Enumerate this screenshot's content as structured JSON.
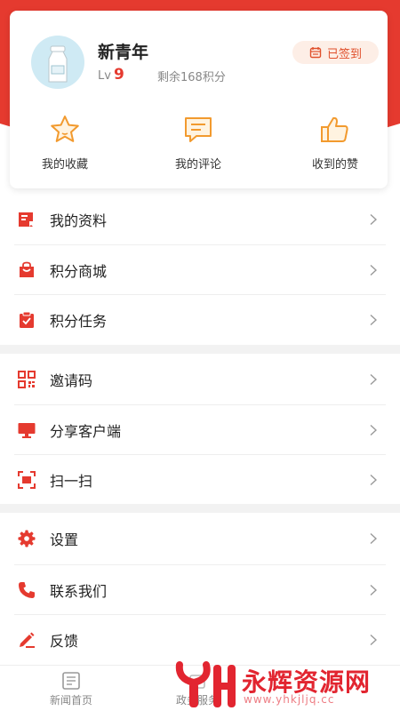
{
  "profile": {
    "username": "新青年",
    "level_label": "Lv",
    "level_value": "9",
    "points_text": "剩余168积分",
    "checkin_label": "已签到",
    "avatar_icon": "milk-bottle-avatar"
  },
  "quick_actions": [
    {
      "label": "我的收藏",
      "icon": "star-icon"
    },
    {
      "label": "我的评论",
      "icon": "comment-icon"
    },
    {
      "label": "收到的赞",
      "icon": "thumbs-up-icon"
    }
  ],
  "menu_groups": [
    [
      {
        "label": "我的资料",
        "icon": "profile-doc-icon"
      },
      {
        "label": "积分商城",
        "icon": "shopping-bag-icon"
      },
      {
        "label": "积分任务",
        "icon": "task-clipboard-icon"
      }
    ],
    [
      {
        "label": "邀请码",
        "icon": "qr-code-icon"
      },
      {
        "label": "分享客户端",
        "icon": "monitor-icon"
      },
      {
        "label": "扫一扫",
        "icon": "scan-icon"
      }
    ],
    [
      {
        "label": "设置",
        "icon": "gear-icon"
      },
      {
        "label": "联系我们",
        "icon": "phone-icon"
      },
      {
        "label": "反馈",
        "icon": "pen-icon"
      }
    ]
  ],
  "tabbar": {
    "tab1": "新闻首页",
    "tab2": "政务服务"
  },
  "watermark": {
    "text": "永辉资源网",
    "sub": "www.yhkjljq.cc"
  },
  "colors": {
    "brand_red": "#e53a2f",
    "icon_orange": "#f29a2e",
    "checkin_bg": "#fdeee6"
  }
}
